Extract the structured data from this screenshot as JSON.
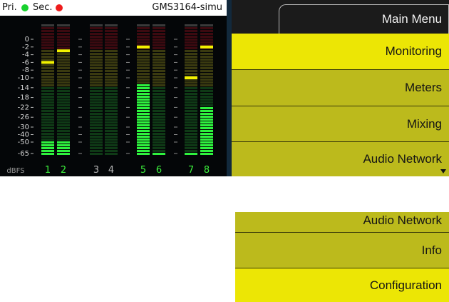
{
  "status_bar": {
    "primary_label": "Pri.",
    "secondary_label": "Sec.",
    "primary_led_color": "#18d12e",
    "secondary_led_color": "#ee1c1c",
    "device_name": "GMS3164-simu"
  },
  "meters": {
    "unit_label": "dBFS",
    "scale_labels": [
      "0",
      "-2",
      "-4",
      "-6",
      "-8",
      "-10",
      "-14",
      "-18",
      "-22",
      "-26",
      "-30",
      "-40",
      "-50",
      "-65"
    ],
    "colors": {
      "green_on": "#2ef23e",
      "green_off": "#0f3a16",
      "yellow_off": "#3a3a10",
      "red_off": "#3c0a10",
      "peak_yellow": "#f2f200",
      "active_label": "#3cf03c",
      "inactive_label": "#b4b4b4"
    },
    "channels": [
      {
        "label": "1",
        "active": true,
        "level_dbfs": -50,
        "peak_dbfs": -6
      },
      {
        "label": "2",
        "active": true,
        "level_dbfs": -48,
        "peak_dbfs": -3
      },
      {
        "label": "3",
        "active": false,
        "level_dbfs": null,
        "peak_dbfs": null
      },
      {
        "label": "4",
        "active": false,
        "level_dbfs": null,
        "peak_dbfs": null
      },
      {
        "label": "5",
        "active": true,
        "level_dbfs": -12,
        "peak_dbfs": -2
      },
      {
        "label": "6",
        "active": true,
        "level_dbfs": -65,
        "peak_dbfs": null
      },
      {
        "label": "7",
        "active": true,
        "level_dbfs": -65,
        "peak_dbfs": -10
      },
      {
        "label": "8",
        "active": true,
        "level_dbfs": -22,
        "peak_dbfs": -2
      }
    ]
  },
  "menu": {
    "title": "Main Menu",
    "items": [
      {
        "label": "Monitoring",
        "selected": true
      },
      {
        "label": "Meters",
        "selected": false
      },
      {
        "label": "Mixing",
        "selected": false
      },
      {
        "label": "Audio Network",
        "selected": false
      }
    ]
  },
  "menu_lower": {
    "items": [
      {
        "label": "Audio Network",
        "selected": false
      },
      {
        "label": "Info",
        "selected": false
      },
      {
        "label": "Configuration",
        "selected": true
      }
    ]
  }
}
